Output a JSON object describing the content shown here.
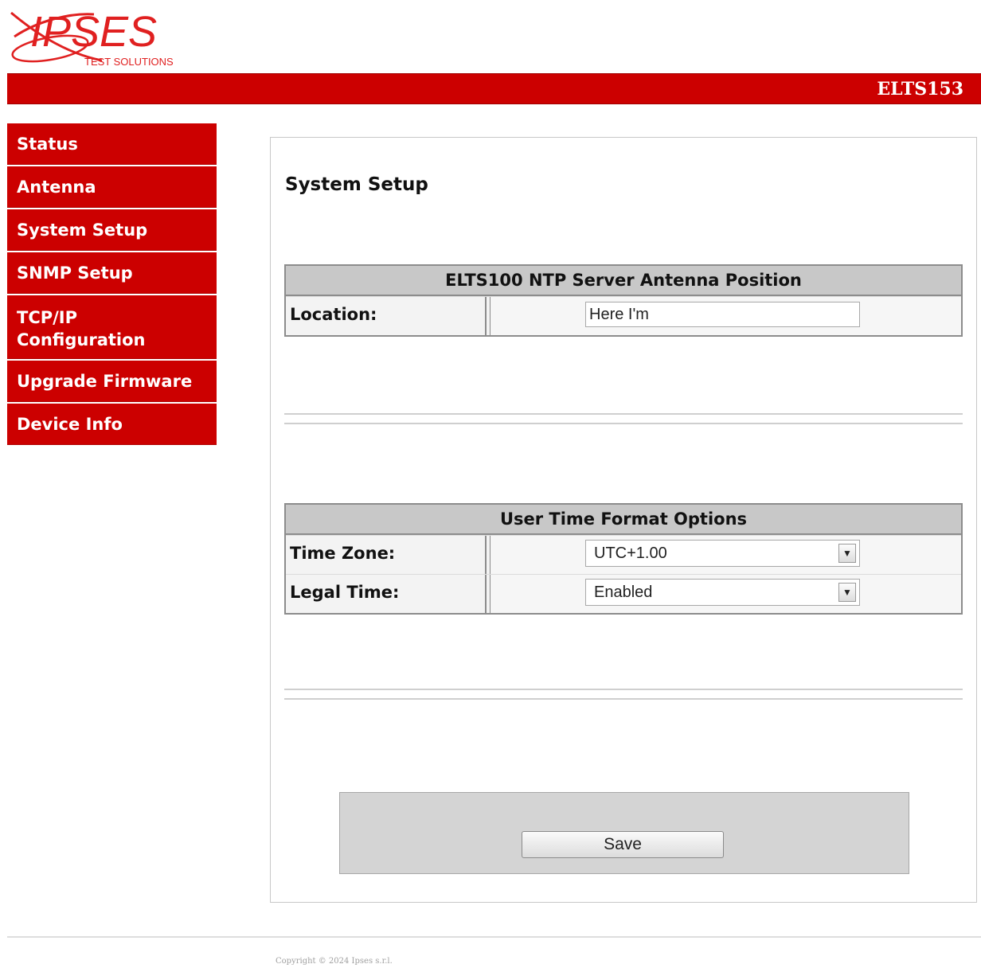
{
  "brand": {
    "logo_text": "IPSES",
    "logo_subtext": "TEST SOLUTIONS",
    "device_name": "ELTS153"
  },
  "sidebar": {
    "items": [
      {
        "label": "Status"
      },
      {
        "label": "Antenna"
      },
      {
        "label": "System Setup"
      },
      {
        "label": "SNMP Setup"
      },
      {
        "label": "TCP/IP Configuration"
      },
      {
        "label": "Upgrade Firmware"
      },
      {
        "label": "Device Info"
      }
    ]
  },
  "main": {
    "title": "System Setup",
    "antenna_panel": {
      "header": "ELTS100 NTP Server Antenna Position",
      "location_label": "Location:",
      "location_value": "Here I'm"
    },
    "time_panel": {
      "header": "User Time Format Options",
      "timezone_label": "Time Zone:",
      "timezone_value": "UTC+1.00",
      "legal_time_label": "Legal Time:",
      "legal_time_value": "Enabled"
    },
    "save_label": "Save"
  },
  "footer": {
    "copyright": "Copyright © 2024 Ipses s.r.l."
  },
  "colors": {
    "accent": "#cc0000",
    "panel_header": "#c8c8c8"
  }
}
